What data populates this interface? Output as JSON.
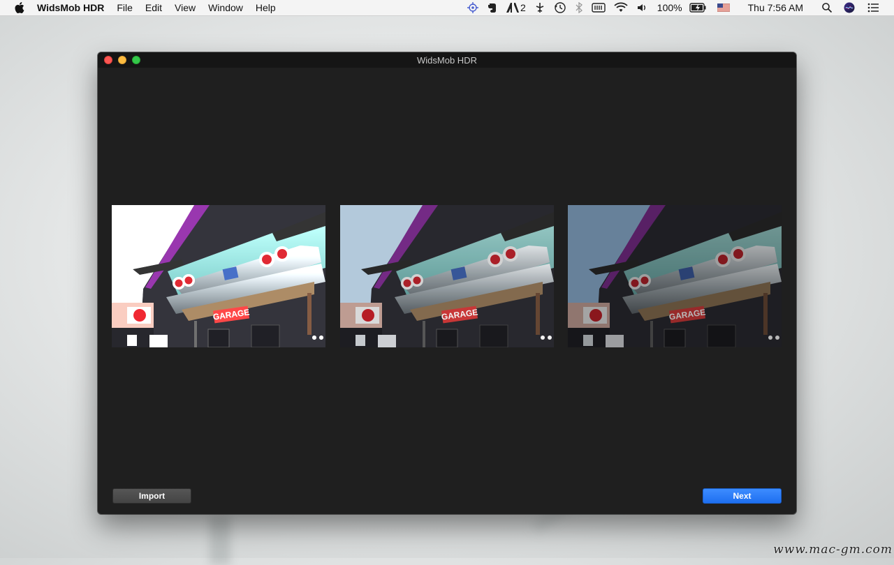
{
  "menubar": {
    "app_name": "WidsMob HDR",
    "items": [
      "File",
      "Edit",
      "View",
      "Window",
      "Help"
    ],
    "adobe_badge": "2",
    "battery": "100%",
    "clock": "Thu 7:56 AM"
  },
  "window": {
    "title": "WidsMob HDR",
    "photos": [
      {
        "exposure": "overexposed"
      },
      {
        "exposure": "normal"
      },
      {
        "exposure": "underexposed"
      }
    ],
    "photo_sign_text": "GARAGE",
    "import_label": "Import",
    "next_label": "Next"
  },
  "watermark": "www.mac-gm.com",
  "colors": {
    "window_bg": "#1f1f1f",
    "next_button": "#2a7bf7",
    "import_button": "#4e4e4e"
  }
}
